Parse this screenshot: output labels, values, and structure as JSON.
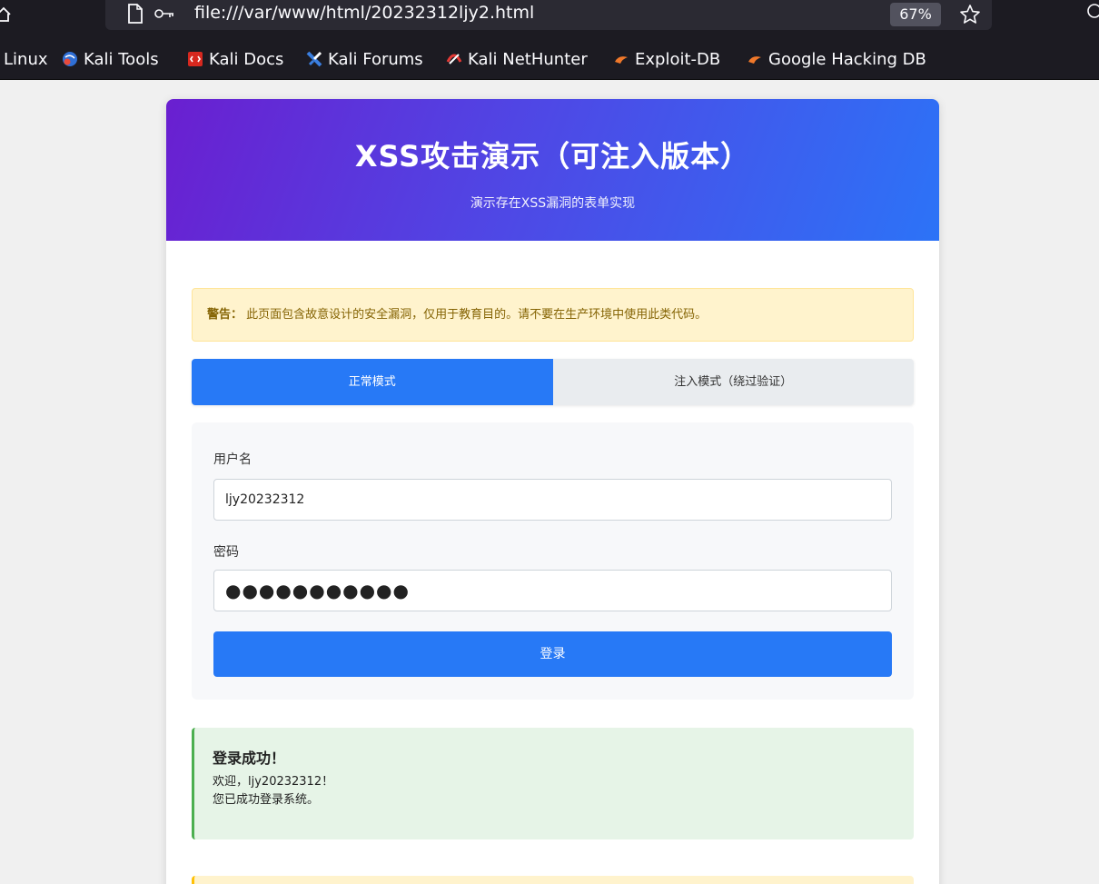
{
  "browser": {
    "url": "file:///var/www/html/20232312ljy2.html",
    "zoom": "67%",
    "bookmarks": [
      {
        "label": "Linux",
        "icon": "none"
      },
      {
        "label": "Kali Tools",
        "icon": "kali-tools-icon"
      },
      {
        "label": "Kali Docs",
        "icon": "kali-docs-icon"
      },
      {
        "label": "Kali Forums",
        "icon": "kali-forums-icon"
      },
      {
        "label": "Kali NetHunter",
        "icon": "kali-nethunter-icon"
      },
      {
        "label": "Exploit-DB",
        "icon": "exploit-db-icon"
      },
      {
        "label": "Google Hacking DB",
        "icon": "exploit-db-icon"
      }
    ]
  },
  "page": {
    "title": "XSS攻击演示（可注入版本）",
    "subtitle": "演示存在XSS漏洞的表单实现",
    "warning": {
      "label": "警告：",
      "text": "此页面包含故意设计的安全漏洞，仅用于教育目的。请不要在生产环境中使用此类代码。"
    },
    "tabs": [
      {
        "label": "正常模式",
        "active": true
      },
      {
        "label": "注入模式（绕过验证）",
        "active": false
      }
    ],
    "form": {
      "username_label": "用户名",
      "username_value": "ljy20232312",
      "password_label": "密码",
      "password_value": "●●●●●●●●●●●",
      "submit_label": "登录"
    },
    "result": {
      "title": "登录成功！",
      "line1": "欢迎，ljy20232312！",
      "line2": "您已成功登录系统。"
    }
  },
  "colors": {
    "accent": "#2779f6",
    "header_start": "#6a1fd0",
    "header_end": "#2c73f7",
    "warning_bg": "#fff3cd",
    "success_bg": "#e6f4e7",
    "success_border": "#4caf50"
  }
}
